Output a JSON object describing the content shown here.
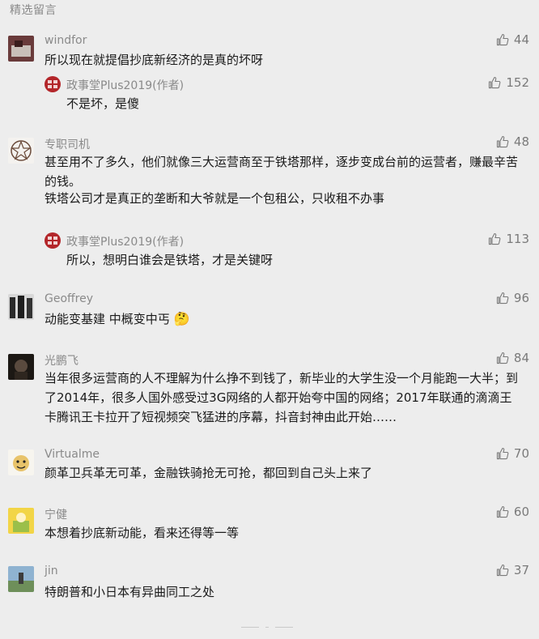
{
  "section_title": "精选留言",
  "comments": [
    {
      "nick": "windfor",
      "text": "所以现在就提倡抄底新经济的是真的坏呀",
      "likes": "44",
      "reply": {
        "nick": "政事堂Plus2019(作者)",
        "text": "不是坏，是傻",
        "likes": "152"
      }
    },
    {
      "nick": "专职司机",
      "text": "甚至用不了多久，他们就像三大运营商至于铁塔那样，逐步变成台前的运营者，赚最辛苦的钱。",
      "text2": "铁塔公司才是真正的垄断和大爷就是一个包租公，只收租不办事",
      "likes": "48",
      "reply": {
        "nick": "政事堂Plus2019(作者)",
        "text": "所以，想明白谁会是铁塔，才是关键呀",
        "likes": "113"
      }
    },
    {
      "nick": "Geoffrey",
      "text": "动能变基建 中概变中丐",
      "likes": "96"
    },
    {
      "nick": "光鹏飞",
      "text": "当年很多运营商的人不理解为什么挣不到钱了，新毕业的大学生没一个月能跑一大半；到了2014年，很多人国外感受过3G网络的人都开始夸中国的网络；2017年联通的滴滴王卡腾讯王卡拉开了短视频突飞猛进的序幕，抖音封神由此开始……",
      "likes": "84"
    },
    {
      "nick": "Virtualme",
      "text": "颜革卫兵革无可革，金融铁骑抢无可抢，都回到自己头上来了",
      "likes": "70"
    },
    {
      "nick": "宁健",
      "text": "本想着抄底新动能，看来还得等一等",
      "likes": "60"
    },
    {
      "nick": "jin",
      "text": "特朗普和小日本有异曲同工之处",
      "likes": "37"
    }
  ],
  "emoji": "🤔",
  "colors": {
    "background": "#ededed",
    "nick": "#8a8a8a",
    "text": "#1a1a1a",
    "author_seal": "#b3262a"
  },
  "icons": {
    "like": "thumbs-up-icon",
    "author_avatar": "red-seal-icon"
  }
}
